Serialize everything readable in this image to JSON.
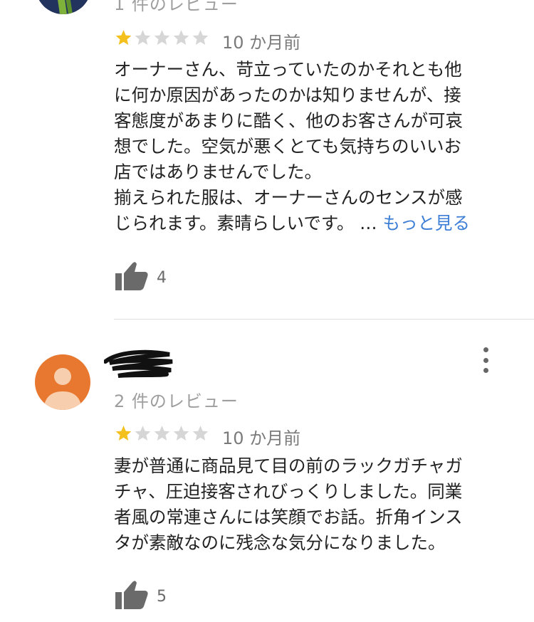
{
  "review1": {
    "review_count": "1 件のレビュー",
    "rating": 1,
    "rating_max": 5,
    "date": "10 か月前",
    "body_lines": [
      "オーナーさん、苛立っていたのかそれとも他",
      "に何か原因があったのかは知りませんが、接",
      "客態度があまりに酷く、他のお客さんが可哀",
      "想でした。空気が悪くとても気持ちのいいお",
      "店ではありませんでした。",
      "揃えられた服は、オーナーさんのセンスが感"
    ],
    "last_line": "じられます。素晴らしいです。 …",
    "more_label": "もっと見る",
    "likes": "4"
  },
  "review2": {
    "review_count": "2 件のレビュー",
    "rating": 1,
    "rating_max": 5,
    "date": "10 か月前",
    "body_lines": [
      "妻が普通に商品見て目の前のラックガチャガ",
      "チャ、圧迫接客されびっくりしました。同業",
      "者風の常連さんには笑顔でお話。折角インス",
      "タが素敵なのに残念な気分になりました。"
    ],
    "likes": "5"
  },
  "colors": {
    "star_filled": "#f4c01e",
    "star_empty": "#d6d6d6",
    "link": "#3d7ed6",
    "avatar_bg": "#e8782f",
    "avatar_fg": "#f7cfae"
  },
  "icons": [
    "thumbs-up-icon",
    "more-vert-icon",
    "star-icon"
  ]
}
